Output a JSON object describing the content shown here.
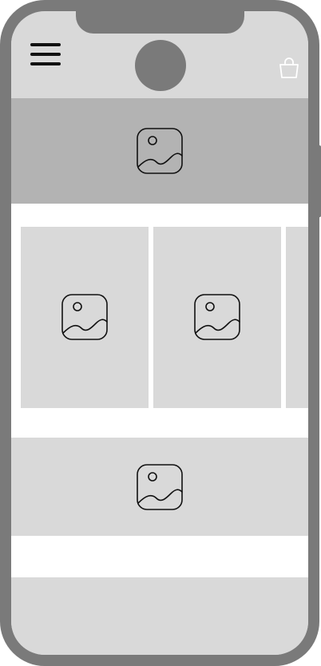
{
  "app": {
    "icons": {
      "menu": "hamburger-menu-icon",
      "logo": "logo-circle",
      "cart": "shopping-bag-icon",
      "image_placeholder": "image-placeholder-icon"
    },
    "colors": {
      "frame": "#7a7a7a",
      "surface": "#d9d9d9",
      "hero": "#b3b3b3",
      "background": "#ffffff",
      "icon_stroke": "#111111"
    }
  },
  "sections": [
    {
      "name": "hero-banner",
      "content": "image-placeholder"
    },
    {
      "name": "product-carousel",
      "items": [
        "image-placeholder",
        "image-placeholder",
        "image-placeholder"
      ]
    },
    {
      "name": "promo-banner",
      "content": "image-placeholder"
    },
    {
      "name": "footer",
      "content": ""
    }
  ]
}
